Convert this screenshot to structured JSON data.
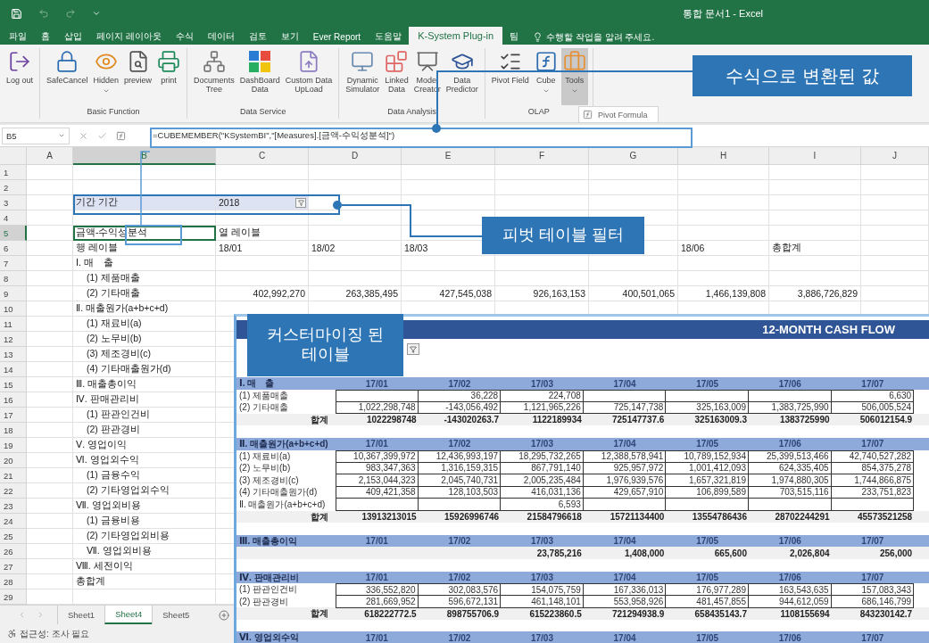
{
  "title_bar": {
    "title": "통합 문서1 - Excel"
  },
  "menu_tabs": [
    {
      "label": "파일",
      "selected": false
    },
    {
      "label": "홈",
      "selected": false
    },
    {
      "label": "삽입",
      "selected": false
    },
    {
      "label": "페이지 레이아웃",
      "selected": false
    },
    {
      "label": "수식",
      "selected": false
    },
    {
      "label": "데이터",
      "selected": false
    },
    {
      "label": "검토",
      "selected": false
    },
    {
      "label": "보기",
      "selected": false
    },
    {
      "label": "Ever Report",
      "selected": false
    },
    {
      "label": "도움말",
      "selected": false
    },
    {
      "label": "K-System Plug-in",
      "selected": true
    },
    {
      "label": "팀",
      "selected": false
    }
  ],
  "tell_me": {
    "placeholder": "수행할 작업을 알려 주세요."
  },
  "ribbon": {
    "groups": [
      {
        "buttons": [
          {
            "lines": [
              "Log out"
            ],
            "dropdown": false,
            "pressed": false
          }
        ]
      },
      {
        "label": "Basic Function",
        "buttons": [
          {
            "lines": [
              "SafeCancel"
            ],
            "dropdown": false,
            "pressed": false
          },
          {
            "lines": [
              "Hidden"
            ],
            "dropdown": true,
            "pressed": false
          },
          {
            "lines": [
              "preview"
            ],
            "dropdown": false,
            "pressed": false
          },
          {
            "lines": [
              "print"
            ],
            "dropdown": false,
            "pressed": false
          }
        ]
      },
      {
        "label": "Data Service",
        "buttons": [
          {
            "lines": [
              "Documents",
              "Tree"
            ],
            "dropdown": false,
            "pressed": false
          },
          {
            "lines": [
              "DashBoard",
              "Data"
            ],
            "dropdown": false,
            "pressed": false
          },
          {
            "lines": [
              "Custom Data",
              "UpLoad"
            ],
            "dropdown": false,
            "pressed": false
          }
        ]
      },
      {
        "label": "Data Analysis",
        "buttons": [
          {
            "lines": [
              "Dynamic",
              "Simulator"
            ],
            "dropdown": false,
            "pressed": false
          },
          {
            "lines": [
              "Linked",
              "Data"
            ],
            "dropdown": false,
            "pressed": false
          },
          {
            "lines": [
              "Model",
              "Creator"
            ],
            "dropdown": false,
            "pressed": false
          },
          {
            "lines": [
              "Data",
              "Predictor"
            ],
            "dropdown": false,
            "pressed": false
          }
        ]
      },
      {
        "label": "OLAP",
        "buttons": [
          {
            "lines": [
              "Pivot Field"
            ],
            "dropdown": false,
            "pressed": false
          },
          {
            "lines": [
              "Cube"
            ],
            "dropdown": true,
            "pressed": false
          },
          {
            "lines": [
              "Tools"
            ],
            "dropdown": true,
            "pressed": true
          }
        ]
      }
    ],
    "menu": {
      "items": [
        {
          "label": "Pivot Formula"
        }
      ]
    }
  },
  "formula_bar": {
    "name_box": "B5",
    "formula": "=CUBEMEMBER(\"KSystemBI\",\"[Measures].[금액-수익성분석]\")"
  },
  "sheet": {
    "columns": [
      {
        "letter": "A",
        "selected": false
      },
      {
        "letter": "B",
        "selected": true
      },
      {
        "letter": "C",
        "selected": false
      },
      {
        "letter": "D",
        "selected": false
      },
      {
        "letter": "E",
        "selected": false
      },
      {
        "letter": "F",
        "selected": false
      },
      {
        "letter": "G",
        "selected": false
      },
      {
        "letter": "H",
        "selected": false
      },
      {
        "letter": "I",
        "selected": false
      },
      {
        "letter": "J",
        "selected": false
      }
    ],
    "rows": [
      {
        "number": "1",
        "selected": false
      },
      {
        "number": "2",
        "selected": false
      },
      {
        "number": "3",
        "selected": false,
        "cells": {
          "B": {
            "kind": "filter-label",
            "text": "기간 기간"
          },
          "C": {
            "kind": "filter-value",
            "text": "2018"
          }
        }
      },
      {
        "number": "4",
        "selected": false
      },
      {
        "number": "5",
        "selected": true,
        "cells": {
          "B": {
            "kind": "text",
            "text": "금액-수익성분석"
          },
          "C": {
            "kind": "text",
            "text": "열 레이블"
          }
        }
      },
      {
        "number": "6",
        "selected": false,
        "cells": {
          "B": {
            "kind": "text",
            "text": "행 레이블"
          },
          "C": {
            "kind": "text",
            "text": "18/01"
          },
          "D": {
            "kind": "text",
            "text": "18/02"
          },
          "E": {
            "kind": "text",
            "text": "18/03"
          },
          "H": {
            "kind": "text",
            "text": "18/06"
          },
          "I": {
            "kind": "text",
            "text": "총합계"
          }
        }
      },
      {
        "number": "7",
        "selected": false,
        "cells": {
          "B": {
            "kind": "text",
            "text": "Ⅰ. 매　출"
          }
        },
        "children": [
          {
            "number": "8",
            "selected": false,
            "cells": {
              "B": {
                "kind": "text",
                "text": "(1) 제품매출"
              }
            }
          },
          {
            "number": "9",
            "selected": false,
            "cells": {
              "B": {
                "kind": "text",
                "text": "(2) 기타매출"
              },
              "C": {
                "kind": "number",
                "text": "402,992,270"
              },
              "D": {
                "kind": "number",
                "text": "263,385,495"
              },
              "E": {
                "kind": "number",
                "text": "427,545,038"
              },
              "F": {
                "kind": "number",
                "text": "926,163,153"
              },
              "G": {
                "kind": "number",
                "text": "400,501,065"
              },
              "H": {
                "kind": "number",
                "text": "1,466,139,808"
              },
              "I": {
                "kind": "number",
                "text": "3,886,726,829"
              }
            }
          }
        ]
      },
      {
        "number": "10",
        "selected": false,
        "cells": {
          "B": {
            "kind": "text",
            "text": "Ⅱ. 매출원가(a+b+c+d)"
          }
        },
        "children": [
          {
            "number": "11",
            "selected": false,
            "cells": {
              "B": {
                "kind": "text",
                "text": "(1) 재료비(a)"
              }
            }
          },
          {
            "number": "12",
            "selected": false,
            "cells": {
              "B": {
                "kind": "text",
                "text": "(2) 노무비(b)"
              }
            }
          },
          {
            "number": "13",
            "selected": false,
            "cells": {
              "B": {
                "kind": "text",
                "text": "(3) 제조경비(c)"
              }
            }
          },
          {
            "number": "14",
            "selected": false,
            "cells": {
              "B": {
                "kind": "text",
                "text": "(4) 기타매출원가(d)"
              }
            }
          }
        ]
      },
      {
        "number": "15",
        "selected": false,
        "cells": {
          "B": {
            "kind": "text",
            "text": "Ⅲ. 매출총이익"
          }
        }
      },
      {
        "number": "16",
        "selected": false,
        "cells": {
          "B": {
            "kind": "text",
            "text": "Ⅳ. 판매관리비"
          }
        },
        "children": [
          {
            "number": "17",
            "selected": false,
            "cells": {
              "B": {
                "kind": "text",
                "text": "(1) 판관인건비"
              }
            }
          },
          {
            "number": "18",
            "selected": false,
            "cells": {
              "B": {
                "kind": "text",
                "text": "(2) 판관경비"
              }
            }
          }
        ]
      },
      {
        "number": "19",
        "selected": false,
        "cells": {
          "B": {
            "kind": "text",
            "text": "Ⅴ. 영업이익"
          }
        }
      },
      {
        "number": "20",
        "selected": false,
        "cells": {
          "B": {
            "kind": "text",
            "text": "Ⅵ. 영업외수익"
          }
        },
        "children": [
          {
            "number": "21",
            "selected": false,
            "cells": {
              "B": {
                "kind": "text",
                "text": "(1) 금융수익"
              }
            }
          },
          {
            "number": "22",
            "selected": false,
            "cells": {
              "B": {
                "kind": "text",
                "text": "(2) 기타영업외수익"
              }
            }
          }
        ]
      },
      {
        "number": "23",
        "selected": false,
        "cells": {
          "B": {
            "kind": "text",
            "text": "Ⅶ. 영업외비용"
          }
        },
        "children": [
          {
            "number": "24",
            "selected": false,
            "cells": {
              "B": {
                "kind": "text",
                "text": "(1) 금융비용"
              }
            }
          },
          {
            "number": "25",
            "selected": false,
            "cells": {
              "B": {
                "kind": "text",
                "text": "(2) 기타영업외비용"
              }
            }
          },
          {
            "number": "26",
            "selected": false,
            "cells": {
              "B": {
                "kind": "text",
                "text": "Ⅶ. 영업외비용"
              }
            }
          }
        ]
      },
      {
        "number": "27",
        "selected": false,
        "cells": {
          "B": {
            "kind": "text",
            "text": "Ⅷ. 세전이익"
          }
        }
      },
      {
        "number": "28",
        "selected": false,
        "cells": {
          "B": {
            "kind": "text",
            "text": "총합계"
          }
        }
      },
      {
        "number": "29",
        "selected": false
      }
    ]
  },
  "sheet_tabs": [
    {
      "label": "Sheet1",
      "selected": false
    },
    {
      "label": "Sheet4",
      "selected": true
    },
    {
      "label": "Sheet5",
      "selected": false
    }
  ],
  "status_bar": {
    "text": "접근성: 조사 필요"
  },
  "cash_flow_table": {
    "title": "12-MONTH CASH FLOW",
    "sections": [
      {
        "title": "Ⅰ. 매　출",
        "columns": [
          "17/01",
          "17/02",
          "17/03",
          "17/04",
          "17/05",
          "17/06",
          "17/07"
        ],
        "rows": [
          {
            "label": "(1) 제품매출",
            "values": [
              {
                "kind": "blank"
              },
              {
                "kind": "value",
                "text": "36,228"
              },
              {
                "kind": "value",
                "text": "224,708"
              },
              {
                "kind": "blank"
              },
              {
                "kind": "blank"
              },
              {
                "kind": "blank"
              },
              {
                "kind": "value",
                "text": "6,630"
              }
            ]
          },
          {
            "label": "(2) 기타매출",
            "values": [
              {
                "kind": "value",
                "text": "1,022,298,748"
              },
              {
                "kind": "value",
                "text": "-143,056,492"
              },
              {
                "kind": "value",
                "text": "1,121,965,226"
              },
              {
                "kind": "value",
                "text": "725,147,738"
              },
              {
                "kind": "value",
                "text": "325,163,009"
              },
              {
                "kind": "value",
                "text": "1,383,725,990"
              },
              {
                "kind": "value",
                "text": "506,005,524"
              }
            ]
          }
        ],
        "total": {
          "label": "합계",
          "values": [
            {
              "kind": "value",
              "text": "1022298748"
            },
            {
              "kind": "value",
              "text": "-143020263.7"
            },
            {
              "kind": "value",
              "text": "1122189934"
            },
            {
              "kind": "value",
              "text": "725147737.6"
            },
            {
              "kind": "value",
              "text": "325163009.3"
            },
            {
              "kind": "value",
              "text": "1383725990"
            },
            {
              "kind": "value",
              "text": "506012154.9"
            }
          ]
        }
      },
      {
        "title": "Ⅱ. 매출원가(a+b+c+d)",
        "columns": [
          "17/01",
          "17/02",
          "17/03",
          "17/04",
          "17/05",
          "17/06",
          "17/07"
        ],
        "rows": [
          {
            "label": "(1) 재료비(a)",
            "values": [
              {
                "kind": "value",
                "text": "10,367,399,972"
              },
              {
                "kind": "value",
                "text": "12,436,993,197"
              },
              {
                "kind": "value",
                "text": "18,295,732,265"
              },
              {
                "kind": "value",
                "text": "12,388,578,941"
              },
              {
                "kind": "value",
                "text": "10,789,152,934"
              },
              {
                "kind": "value",
                "text": "25,399,513,466"
              },
              {
                "kind": "value",
                "text": "42,740,527,282"
              }
            ]
          },
          {
            "label": "(2) 노무비(b)",
            "values": [
              {
                "kind": "value",
                "text": "983,347,363"
              },
              {
                "kind": "value",
                "text": "1,316,159,315"
              },
              {
                "kind": "value",
                "text": "867,791,140"
              },
              {
                "kind": "value",
                "text": "925,957,972"
              },
              {
                "kind": "value",
                "text": "1,001,412,093"
              },
              {
                "kind": "value",
                "text": "624,335,405"
              },
              {
                "kind": "value",
                "text": "854,375,278"
              }
            ]
          },
          {
            "label": "(3) 제조경비(c)",
            "values": [
              {
                "kind": "value",
                "text": "2,153,044,323"
              },
              {
                "kind": "value",
                "text": "2,045,740,731"
              },
              {
                "kind": "value",
                "text": "2,005,235,484"
              },
              {
                "kind": "value",
                "text": "1,976,939,576"
              },
              {
                "kind": "value",
                "text": "1,657,321,819"
              },
              {
                "kind": "value",
                "text": "1,974,880,305"
              },
              {
                "kind": "value",
                "text": "1,744,866,875"
              }
            ]
          },
          {
            "label": "(4) 기타매출원가(d)",
            "values": [
              {
                "kind": "value",
                "text": "409,421,358"
              },
              {
                "kind": "value",
                "text": "128,103,503"
              },
              {
                "kind": "value",
                "text": "416,031,136"
              },
              {
                "kind": "value",
                "text": "429,657,910"
              },
              {
                "kind": "value",
                "text": "106,899,589"
              },
              {
                "kind": "value",
                "text": "703,515,116"
              },
              {
                "kind": "value",
                "text": "233,751,823"
              }
            ]
          },
          {
            "label": "Ⅱ. 매출원가(a+b+c+d)",
            "values": [
              {
                "kind": "blank"
              },
              {
                "kind": "blank"
              },
              {
                "kind": "value",
                "text": "6,593"
              },
              {
                "kind": "blank"
              },
              {
                "kind": "blank"
              },
              {
                "kind": "blank"
              },
              {
                "kind": "blank"
              }
            ]
          }
        ],
        "total": {
          "label": "합계",
          "values": [
            {
              "kind": "value",
              "text": "13913213015"
            },
            {
              "kind": "value",
              "text": "15926996746"
            },
            {
              "kind": "value",
              "text": "21584796618"
            },
            {
              "kind": "value",
              "text": "15721134400"
            },
            {
              "kind": "value",
              "text": "13554786436"
            },
            {
              "kind": "value",
              "text": "28702244291"
            },
            {
              "kind": "value",
              "text": "45573521258"
            }
          ]
        }
      },
      {
        "title": "Ⅲ. 매출총이익",
        "columns": [
          "17/01",
          "17/02",
          "17/03",
          "17/04",
          "17/05",
          "17/06",
          "17/07"
        ],
        "total": {
          "values": [
            {
              "kind": "blank"
            },
            {
              "kind": "blank"
            },
            {
              "kind": "value",
              "text": "23,785,216"
            },
            {
              "kind": "value",
              "text": "1,408,000"
            },
            {
              "kind": "value",
              "text": "665,600"
            },
            {
              "kind": "value",
              "text": "2,026,804"
            },
            {
              "kind": "value",
              "text": "256,000"
            }
          ]
        }
      },
      {
        "title": "Ⅳ. 판매관리비",
        "columns": [
          "17/01",
          "17/02",
          "17/03",
          "17/04",
          "17/05",
          "17/06",
          "17/07"
        ],
        "rows": [
          {
            "label": "(1) 판관인건비",
            "values": [
              {
                "kind": "value",
                "text": "336,552,820"
              },
              {
                "kind": "value",
                "text": "302,083,576"
              },
              {
                "kind": "value",
                "text": "154,075,759"
              },
              {
                "kind": "value",
                "text": "167,336,013"
              },
              {
                "kind": "value",
                "text": "176,977,289"
              },
              {
                "kind": "value",
                "text": "163,543,635"
              },
              {
                "kind": "value",
                "text": "157,083,343"
              }
            ]
          },
          {
            "label": "(2) 판관경비",
            "values": [
              {
                "kind": "value",
                "text": "281,669,952"
              },
              {
                "kind": "value",
                "text": "596,672,131"
              },
              {
                "kind": "value",
                "text": "461,148,101"
              },
              {
                "kind": "value",
                "text": "553,958,926"
              },
              {
                "kind": "value",
                "text": "481,457,855"
              },
              {
                "kind": "value",
                "text": "944,612,059"
              },
              {
                "kind": "value",
                "text": "686,146,799"
              }
            ]
          }
        ],
        "total": {
          "label": "합계",
          "values": [
            {
              "kind": "value",
              "text": "618222772.5"
            },
            {
              "kind": "value",
              "text": "898755706.9"
            },
            {
              "kind": "value",
              "text": "615223860.5"
            },
            {
              "kind": "value",
              "text": "721294938.9"
            },
            {
              "kind": "value",
              "text": "658435143.7"
            },
            {
              "kind": "value",
              "text": "1108155694"
            },
            {
              "kind": "value",
              "text": "843230142.7"
            }
          ]
        }
      },
      {
        "title": "Ⅵ. 영업외수익",
        "columns": [
          "17/01",
          "17/02",
          "17/03",
          "17/04",
          "17/05",
          "17/06",
          "17/07"
        ]
      }
    ]
  },
  "callouts": [
    {
      "text": "수식으로 변환된 값"
    },
    {
      "text": "피벗 테이블 필터"
    },
    {
      "text": "커스터마이징 된 테이블"
    }
  ]
}
